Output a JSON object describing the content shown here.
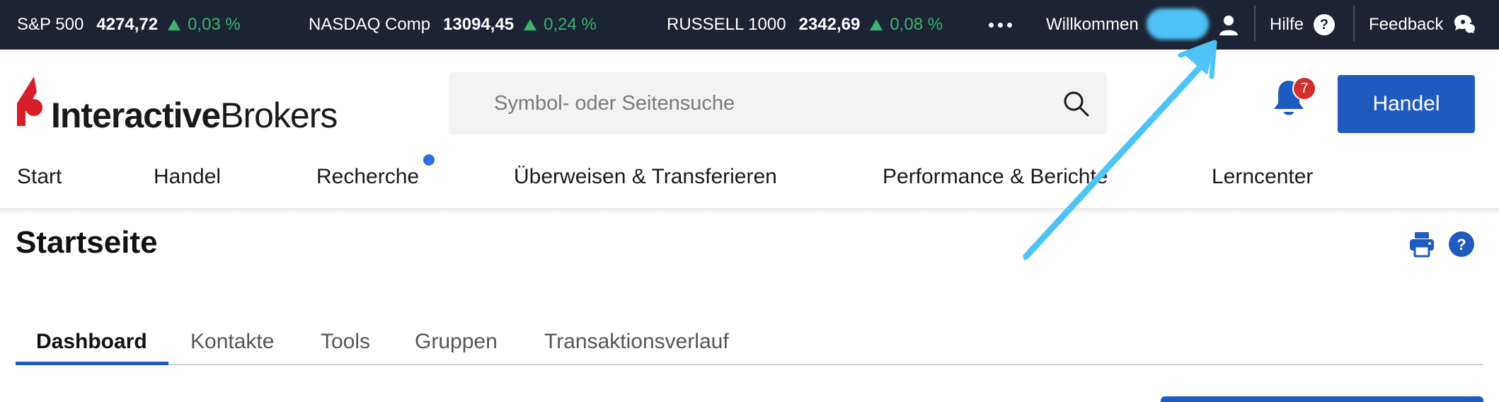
{
  "ticker": [
    {
      "name": "S&P 500",
      "value": "4274,72",
      "change": "0,03 %"
    },
    {
      "name": "NASDAQ Comp",
      "value": "13094,45",
      "change": "0,24 %"
    },
    {
      "name": "RUSSELL 1000",
      "value": "2342,69",
      "change": "0,08 %"
    }
  ],
  "topbar": {
    "welcome": "Willkommen",
    "help_label": "Hilfe",
    "help_glyph": "?",
    "feedback_label": "Feedback"
  },
  "logo": {
    "part1": "Interactive",
    "part2": "Brokers"
  },
  "search": {
    "placeholder": "Symbol- oder Seitensuche"
  },
  "notifications": {
    "count": "7"
  },
  "trade_button": "Handel",
  "nav": [
    "Start",
    "Handel",
    "Recherche",
    "Überweisen & Transferieren",
    "Performance & Berichte",
    "Lerncenter"
  ],
  "page": {
    "title": "Startseite",
    "help_glyph": "?"
  },
  "tabs": [
    "Dashboard",
    "Kontakte",
    "Tools",
    "Gruppen",
    "Transaktionsverlauf"
  ],
  "colors": {
    "ticker_bg": "#1c2332",
    "positive": "#3cb371",
    "brand_blue": "#1f5bbf",
    "brand_red": "#d81e2a",
    "annotation": "#4fc3f7",
    "badge": "#d32f2f"
  }
}
